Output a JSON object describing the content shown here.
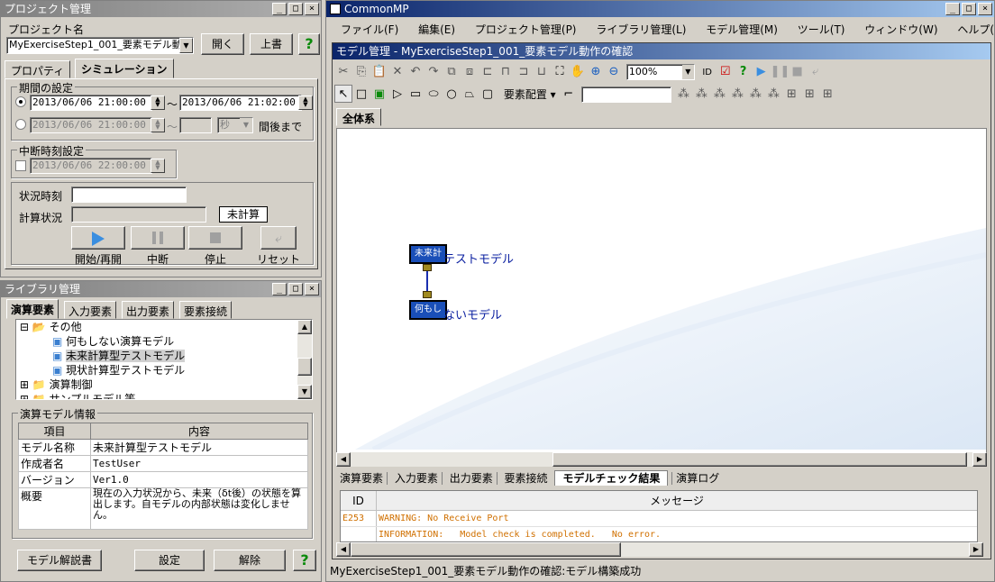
{
  "project": {
    "title": "プロジェクト管理",
    "name_label": "プロジェクト名",
    "name_value": "MyExerciseStep1_001_要素モデル動",
    "open_btn": "開く",
    "overwrite_btn": "上書",
    "help": "?",
    "tabs": [
      "プロパティ",
      "シミュレーション"
    ],
    "period_label": "期間の設定",
    "start1": "2013/06/06 21:00:00",
    "end1": "2013/06/06 21:02:00",
    "tilde": "〜",
    "start2": "2013/06/06 21:00:00",
    "unit": "秒",
    "until_text": "間後まで",
    "interrupt_label": "中断時刻設定",
    "interrupt_time": "2013/06/06 22:00:00",
    "status_time_label": "状況時刻",
    "status_time_value": "",
    "calc_status_label": "計算状況",
    "calc_status_value": "未計算",
    "controls": [
      "開始/再開",
      "中断",
      "停止",
      "リセット"
    ]
  },
  "library": {
    "title": "ライブラリ管理",
    "tabs": [
      "演算要素",
      "入力要素",
      "出力要素",
      "要素接続"
    ],
    "tree": [
      "その他",
      "何もしない演算モデル",
      "未来計算型テストモデル",
      "現状計算型テストモデル",
      "演算制御",
      "サンプルモデル等"
    ],
    "info_label": "演算モデル情報",
    "col_item": "項目",
    "col_content": "内容",
    "rows": [
      {
        "k": "モデル名称",
        "v": "未来計算型テストモデル"
      },
      {
        "k": "作成者名",
        "v": "TestUser"
      },
      {
        "k": "バージョン",
        "v": "Ver1.0"
      },
      {
        "k": "概要",
        "v": "現在の入力状況から、未来（δt後）の状態を算出します。自モデルの内部状態は変化しません。"
      }
    ],
    "btn_manual": "モデル解説書",
    "btn_settings": "設定",
    "btn_remove": "解除",
    "help": "?"
  },
  "main": {
    "title": "CommonMP",
    "menu": [
      "ファイル(F)",
      "編集(E)",
      "プロジェクト管理(P)",
      "ライブラリ管理(L)",
      "モデル管理(M)",
      "ツール(T)",
      "ウィンドウ(W)",
      "ヘルプ(H)"
    ],
    "model_window_title": "モデル管理 - MyExerciseStep1_001_要素モデル動作の確認",
    "zoom": "100%",
    "layout_label": "要素配置",
    "canvas_tab": "全体系",
    "node1_icon": "未来計",
    "node1_label": "テストモデル",
    "node2_icon": "何もし",
    "node2_label": "ないモデル",
    "bottom_tabs": [
      "演算要素",
      "入力要素",
      "出力要素",
      "要素接続",
      "モデルチェック結果",
      "演算ログ"
    ],
    "msg_col_id": "ID",
    "msg_col_msg": "メッセージ",
    "messages": [
      {
        "id": "E253",
        "text": "WARNING: No Receive Port"
      },
      {
        "id": "",
        "text": "INFORMATION:   Model check is completed.   No error."
      }
    ],
    "status": "MyExerciseStep1_001_要素モデル動作の確認:モデル構築成功"
  },
  "colors": {
    "active_title": "#0a246a",
    "node": "#1a4fb8",
    "warn": "#d07000"
  }
}
